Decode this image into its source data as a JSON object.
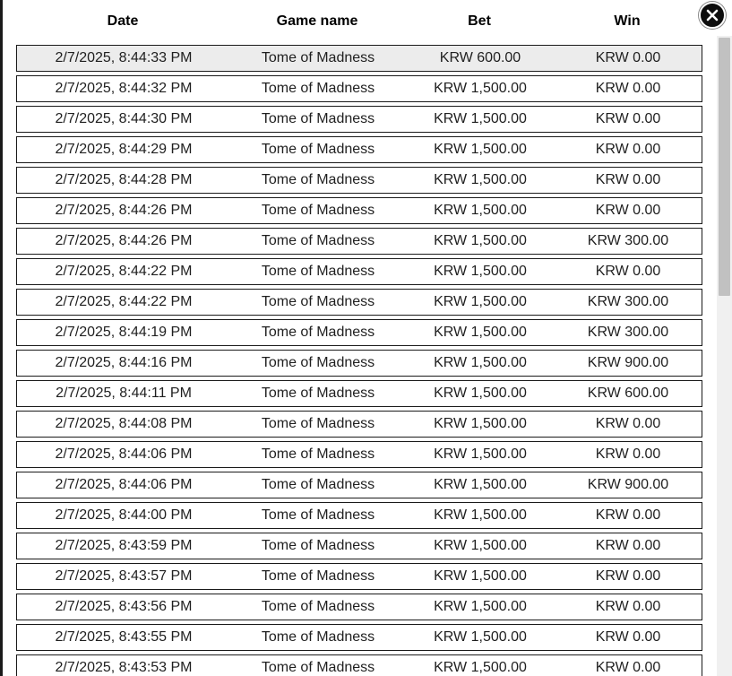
{
  "table": {
    "headers": {
      "date": "Date",
      "game": "Game name",
      "bet": "Bet",
      "win": "Win"
    },
    "rows": [
      {
        "date": "2/7/2025, 8:44:33 PM",
        "game": "Tome of Madness",
        "bet": "KRW 600.00",
        "win": "KRW 0.00"
      },
      {
        "date": "2/7/2025, 8:44:32 PM",
        "game": "Tome of Madness",
        "bet": "KRW 1,500.00",
        "win": "KRW 0.00"
      },
      {
        "date": "2/7/2025, 8:44:30 PM",
        "game": "Tome of Madness",
        "bet": "KRW 1,500.00",
        "win": "KRW 0.00"
      },
      {
        "date": "2/7/2025, 8:44:29 PM",
        "game": "Tome of Madness",
        "bet": "KRW 1,500.00",
        "win": "KRW 0.00"
      },
      {
        "date": "2/7/2025, 8:44:28 PM",
        "game": "Tome of Madness",
        "bet": "KRW 1,500.00",
        "win": "KRW 0.00"
      },
      {
        "date": "2/7/2025, 8:44:26 PM",
        "game": "Tome of Madness",
        "bet": "KRW 1,500.00",
        "win": "KRW 0.00"
      },
      {
        "date": "2/7/2025, 8:44:26 PM",
        "game": "Tome of Madness",
        "bet": "KRW 1,500.00",
        "win": "KRW 300.00"
      },
      {
        "date": "2/7/2025, 8:44:22 PM",
        "game": "Tome of Madness",
        "bet": "KRW 1,500.00",
        "win": "KRW 0.00"
      },
      {
        "date": "2/7/2025, 8:44:22 PM",
        "game": "Tome of Madness",
        "bet": "KRW 1,500.00",
        "win": "KRW 300.00"
      },
      {
        "date": "2/7/2025, 8:44:19 PM",
        "game": "Tome of Madness",
        "bet": "KRW 1,500.00",
        "win": "KRW 300.00"
      },
      {
        "date": "2/7/2025, 8:44:16 PM",
        "game": "Tome of Madness",
        "bet": "KRW 1,500.00",
        "win": "KRW 900.00"
      },
      {
        "date": "2/7/2025, 8:44:11 PM",
        "game": "Tome of Madness",
        "bet": "KRW 1,500.00",
        "win": "KRW 600.00"
      },
      {
        "date": "2/7/2025, 8:44:08 PM",
        "game": "Tome of Madness",
        "bet": "KRW 1,500.00",
        "win": "KRW 0.00"
      },
      {
        "date": "2/7/2025, 8:44:06 PM",
        "game": "Tome of Madness",
        "bet": "KRW 1,500.00",
        "win": "KRW 0.00"
      },
      {
        "date": "2/7/2025, 8:44:06 PM",
        "game": "Tome of Madness",
        "bet": "KRW 1,500.00",
        "win": "KRW 900.00"
      },
      {
        "date": "2/7/2025, 8:44:00 PM",
        "game": "Tome of Madness",
        "bet": "KRW 1,500.00",
        "win": "KRW 0.00"
      },
      {
        "date": "2/7/2025, 8:43:59 PM",
        "game": "Tome of Madness",
        "bet": "KRW 1,500.00",
        "win": "KRW 0.00"
      },
      {
        "date": "2/7/2025, 8:43:57 PM",
        "game": "Tome of Madness",
        "bet": "KRW 1,500.00",
        "win": "KRW 0.00"
      },
      {
        "date": "2/7/2025, 8:43:56 PM",
        "game": "Tome of Madness",
        "bet": "KRW 1,500.00",
        "win": "KRW 0.00"
      },
      {
        "date": "2/7/2025, 8:43:55 PM",
        "game": "Tome of Madness",
        "bet": "KRW 1,500.00",
        "win": "KRW 0.00"
      },
      {
        "date": "2/7/2025, 8:43:53 PM",
        "game": "Tome of Madness",
        "bet": "KRW 1,500.00",
        "win": "KRW 0.00"
      }
    ]
  },
  "icons": {
    "close": "close-icon"
  },
  "colors": {
    "selected_row_bg": "#ececec",
    "close_button_bg": "#0d0d0d"
  }
}
